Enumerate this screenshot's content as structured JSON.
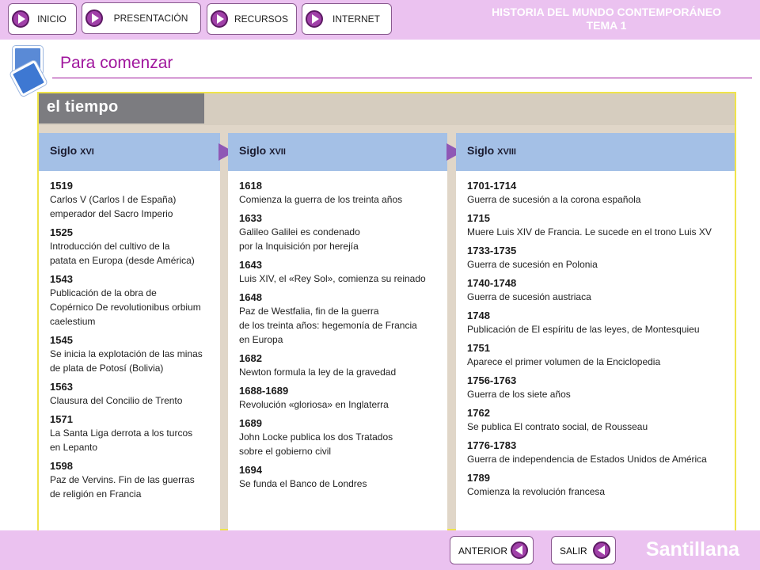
{
  "nav": {
    "inicio": "INICIO",
    "presentacion": "PRESENTACIÓN",
    "recursos": "RECURSOS",
    "internet": "INTERNET"
  },
  "app_title": {
    "line1": "HISTORIA DEL MUNDO CONTEMPORÁNEO",
    "line2": "TEMA 1"
  },
  "page_title": "Para comenzar",
  "banner": "el tiempo",
  "columns": [
    {
      "head": "Siglo ",
      "head_num": "XVI",
      "entries": [
        {
          "year": "1519",
          "desc": "Carlos V (Carlos I de España)\nemperador del Sacro Imperio"
        },
        {
          "year": "1525",
          "desc": "Introducción del cultivo de la\npatata en Europa (desde América)"
        },
        {
          "year": "1543",
          "desc": "Publicación de la obra de\nCopérnico De revolutionibus orbium\ncaelestium"
        },
        {
          "year": "1545",
          "desc": "Se inicia la explotación de las minas\nde plata de Potosí (Bolivia)"
        },
        {
          "year": "1563",
          "desc": "Clausura del Concilio de Trento"
        },
        {
          "year": "1571",
          "desc": "La Santa Liga derrota a los turcos\nen Lepanto"
        },
        {
          "year": "1598",
          "desc": "Paz de Vervins. Fin de las guerras\nde religión en Francia"
        }
      ]
    },
    {
      "head": "Siglo ",
      "head_num": "XVII",
      "entries": [
        {
          "year": "1618",
          "desc": "Comienza la guerra de los treinta años"
        },
        {
          "year": "1633",
          "desc": "Galileo Galilei es condenado\npor la Inquisición por herejía"
        },
        {
          "year": "1643",
          "desc": "Luis XIV, el «Rey Sol», comienza su reinado"
        },
        {
          "year": "1648",
          "desc": "Paz de Westfalia, fin de la guerra\nde los treinta años: hegemonía de Francia\nen Europa"
        },
        {
          "year": "1682",
          "desc": "Newton formula la ley de la gravedad"
        },
        {
          "year": "1688-1689",
          "desc": "Revolución «gloriosa» en Inglaterra"
        },
        {
          "year": "1689",
          "desc": "John Locke publica los dos Tratados\nsobre el gobierno civil"
        },
        {
          "year": "1694",
          "desc": "Se funda el Banco de Londres"
        }
      ]
    },
    {
      "head": "Siglo ",
      "head_num": "XVIII",
      "entries": [
        {
          "year": "1701-1714",
          "desc": "Guerra de sucesión a la corona española"
        },
        {
          "year": "1715",
          "desc": "Muere Luis XIV de Francia. Le sucede en el trono Luis XV"
        },
        {
          "year": "1733-1735",
          "desc": "Guerra de sucesión en Polonia"
        },
        {
          "year": "1740-1748",
          "desc": "Guerra de sucesión austriaca"
        },
        {
          "year": "1748",
          "desc": "Publicación de El espíritu de las leyes, de Montesquieu"
        },
        {
          "year": "1751",
          "desc": "Aparece el primer volumen de la Enciclopedia"
        },
        {
          "year": "1756-1763",
          "desc": "Guerra de los siete años"
        },
        {
          "year": "1762",
          "desc": "Se publica El contrato social, de Rousseau"
        },
        {
          "year": "1776-1783",
          "desc": "Guerra de independencia de Estados Unidos de América"
        },
        {
          "year": "1789",
          "desc": "Comienza la revolución francesa"
        }
      ]
    }
  ],
  "footer": {
    "anterior": "ANTERIOR",
    "salir": "SALIR",
    "brand": "Santillana"
  },
  "colors": {
    "bar": "#ebc2f0",
    "accent": "#a0169d",
    "column_head": "#a4c0e6",
    "arrow": "#8f58b5",
    "panel_border": "#f0e44a"
  }
}
